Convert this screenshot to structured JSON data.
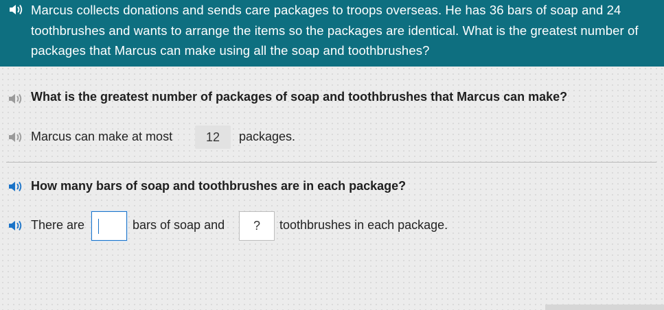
{
  "banner": {
    "text": "Marcus collects donations and sends care packages to troops overseas. He has 36 bars of soap and 24 toothbrushes and wants to arrange the items so the packages are identical. What is the greatest number of packages that Marcus can make using all the soap and toothbrushes?",
    "bg_color": "#0e6f80"
  },
  "question1": {
    "prompt": "What is the greatest number of packages of soap and toothbrushes that Marcus can make?",
    "answer_prefix": "Marcus can make at most",
    "answer_value": "12",
    "answer_suffix": "packages."
  },
  "question2": {
    "prompt": "How many bars of soap and toothbrushes are in each package?",
    "sentence_part1": "There are",
    "input1_value": "",
    "sentence_part2": "bars of soap and",
    "input2_value": "?",
    "sentence_part3": "toothbrushes in each package."
  },
  "icons": {
    "speaker_active": "speaker-icon",
    "speaker_inactive": "speaker-icon",
    "active_color": "#1a73c8",
    "inactive_color": "#9a9a9a"
  }
}
